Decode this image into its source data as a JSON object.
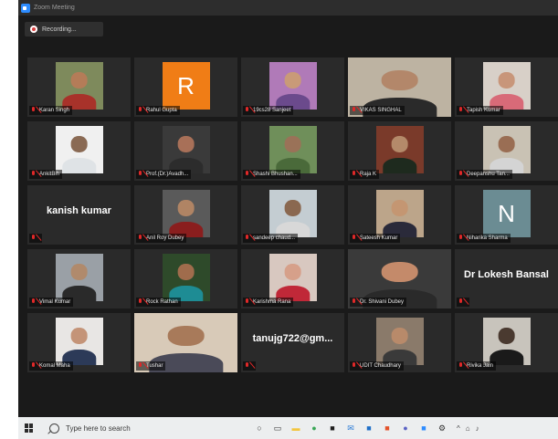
{
  "window": {
    "title": "Zoom Meeting"
  },
  "recording": {
    "label": "Recording..."
  },
  "participants": [
    {
      "name": "Karan Singh",
      "kind": "photo",
      "skin": "#b47c58",
      "shirt": "#a8322a",
      "bg": "#7e8a5c"
    },
    {
      "name": "Rahul Gupta",
      "kind": "letter",
      "letter": "R",
      "avatar_color": "#f07d16"
    },
    {
      "name": "19cs28 Sanjeet",
      "kind": "photo",
      "skin": "#c99a78",
      "shirt": "#6b4a8c",
      "bg": "#b07ab8"
    },
    {
      "name": "VIKAS SINGHAL",
      "kind": "video",
      "active": true,
      "skin": "#b3876a",
      "shirt": "#2a2a2a",
      "bg": "#bdb3a2"
    },
    {
      "name": "Tapish Kumar",
      "kind": "photo",
      "skin": "#c8967a",
      "shirt": "#d86a78",
      "bg": "#d8d0c8"
    },
    {
      "name": "AnkitBih",
      "kind": "photo",
      "skin": "#8a6a54",
      "shirt": "#dfe3e6",
      "bg": "#f0f0f0"
    },
    {
      "name": "Prof.(Dr.)Avadh...",
      "kind": "photo",
      "skin": "#a87058",
      "shirt": "#2c2c2c",
      "bg": "#3a3a3a"
    },
    {
      "name": "Shashi Bhushan...",
      "kind": "photo",
      "skin": "#9a7258",
      "shirt": "#4a6a3a",
      "bg": "#6f8f5a"
    },
    {
      "name": "Raja K",
      "kind": "photo",
      "skin": "#b48a6a",
      "shirt": "#1e2a1e",
      "bg": "#7a3a2a"
    },
    {
      "name": "Deepanshu Tan...",
      "kind": "photo",
      "skin": "#9a6e54",
      "shirt": "#d4d4d4",
      "bg": "#c9c2b4"
    },
    {
      "name": "",
      "kind": "name",
      "display": "kanish kumar"
    },
    {
      "name": "Anil Roy Dubey",
      "kind": "photo",
      "skin": "#b08464",
      "shirt": "#8a1e1e",
      "bg": "#5a5a5a"
    },
    {
      "name": "sandeep chaud...",
      "kind": "photo",
      "skin": "#8a6850",
      "shirt": "#d8d8d8",
      "bg": "#c4cdd2"
    },
    {
      "name": "Sateesh Kumar",
      "kind": "photo",
      "skin": "#c49672",
      "shirt": "#2a2a3a",
      "bg": "#bca58a"
    },
    {
      "name": "Niharika Sharma",
      "kind": "letter",
      "letter": "N",
      "avatar_color": "#6b8c93"
    },
    {
      "name": "Vimal Kumar",
      "kind": "photo",
      "skin": "#b08a6c",
      "shirt": "#2a2a2a",
      "bg": "#9aa0a6"
    },
    {
      "name": "Rock Rathan",
      "kind": "photo",
      "skin": "#a06c4c",
      "shirt": "#1e8c94",
      "bg": "#2e4a2a"
    },
    {
      "name": "Karishma Rana",
      "kind": "photo",
      "skin": "#d6a08a",
      "shirt": "#c02838",
      "bg": "#d8c8c0"
    },
    {
      "name": "Dr. Shivani Dubey",
      "kind": "video",
      "skin": "#c48a6a",
      "shirt": "#2a2a2a",
      "bg": "#3a3a3a"
    },
    {
      "name": "",
      "kind": "name",
      "display": "Dr Lokesh Bansal"
    },
    {
      "name": "Komal Maha",
      "kind": "photo",
      "skin": "#c49478",
      "shirt": "#2c3a58",
      "bg": "#e8e6e4"
    },
    {
      "name": "Tushar",
      "kind": "video",
      "skin": "#a87a5a",
      "shirt": "#4a4a58",
      "bg": "#d8cab8"
    },
    {
      "name": "",
      "kind": "name",
      "display": "tanujg722@gm..."
    },
    {
      "name": "UDIT Chaudhary",
      "kind": "photo",
      "skin": "#b88a6a",
      "shirt": "#3a3a3a",
      "bg": "#8a7a6a"
    },
    {
      "name": "Rivika Jain",
      "kind": "photo",
      "skin": "#4a3a30",
      "shirt": "#1a1a1a",
      "bg": "#c8c4bc"
    }
  ],
  "taskbar": {
    "search_placeholder": "Type here to search",
    "pinned_icons": [
      "cortana-icon",
      "task-view-icon",
      "file-explorer-icon",
      "chrome-icon",
      "store-icon",
      "mail-icon",
      "outlook-icon",
      "office-icon",
      "teams-icon",
      "zoom-icon",
      "settings-icon"
    ],
    "tray_icons": [
      "tray-chevron-icon",
      "network-icon",
      "speaker-icon"
    ]
  }
}
